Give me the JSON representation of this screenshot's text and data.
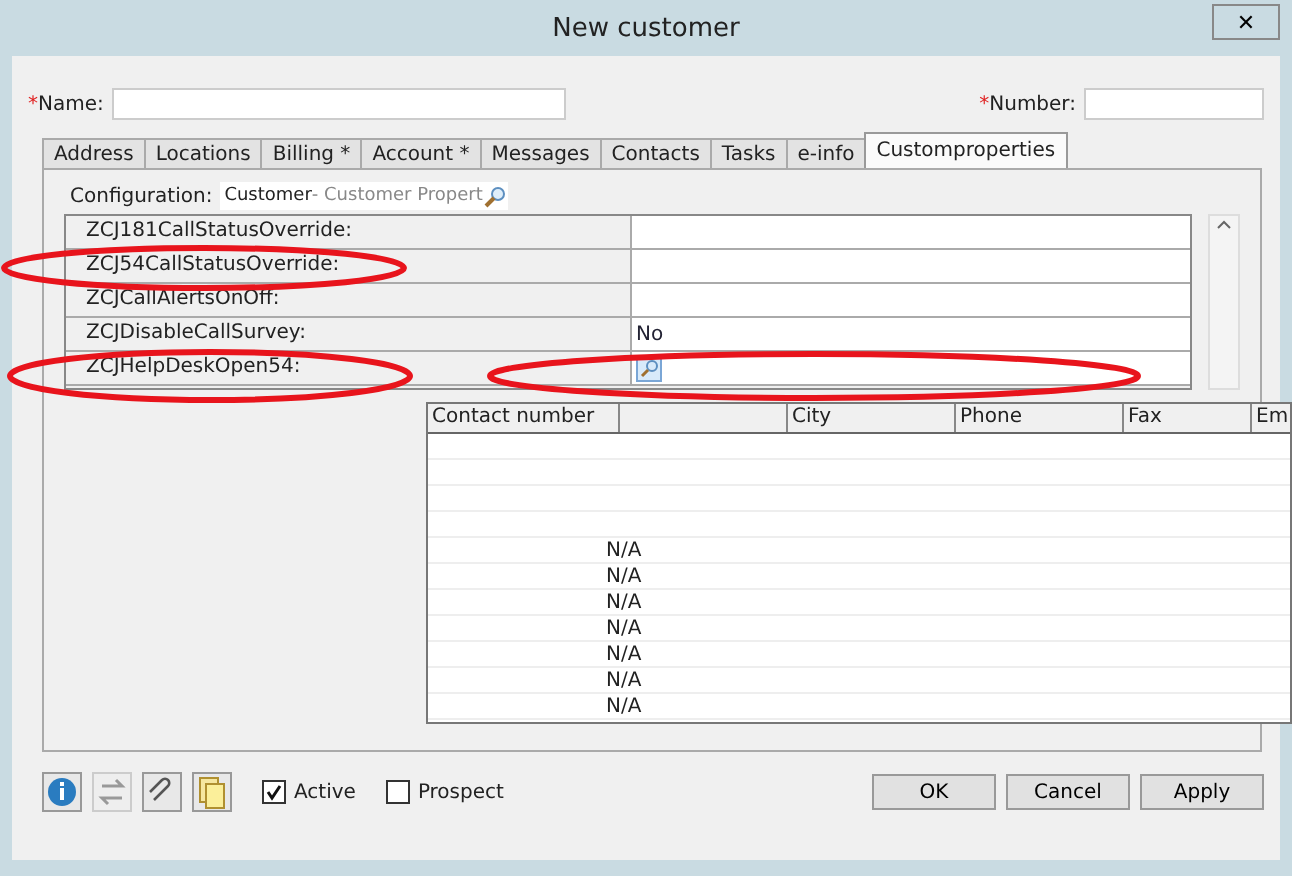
{
  "window": {
    "title": "New customer",
    "close": "✕"
  },
  "fields": [
    {
      "label": "Name:",
      "required": "*"
    },
    {
      "label": "Number:",
      "required": "*"
    }
  ],
  "tabs": [
    {
      "label": "Address",
      "selected": false
    },
    {
      "label": "Locations",
      "selected": false
    },
    {
      "label": "Billing  *",
      "selected": false
    },
    {
      "label": "Account *",
      "selected": false
    },
    {
      "label": "Messages",
      "selected": false
    },
    {
      "label": "Contacts",
      "selected": false
    },
    {
      "label": "Tasks",
      "selected": false
    },
    {
      "label": "e-info",
      "selected": false
    },
    {
      "label": "Customproperties",
      "selected": true
    }
  ],
  "configuration": {
    "label": "Configuration:",
    "value": "Customer",
    "hint": " - Customer Propert"
  },
  "properties": [
    {
      "name": "ZCJ181CallStatusOverride:"
    },
    {
      "name": "ZCJ54CallStatusOverride:"
    },
    {
      "name": "ZCJCallAlertsOnOff:"
    },
    {
      "name": "ZCJDisableCallSurvey:",
      "value": "No"
    },
    {
      "name": "ZCJHelpDeskOpen54:",
      "lookup": true
    }
  ],
  "dropdown": {
    "columns": [
      {
        "label": "Contact number"
      },
      {},
      {
        "label": "City"
      },
      {
        "label": "Phone"
      },
      {
        "label": "Fax"
      },
      {
        "label": "Em"
      }
    ],
    "rows": [
      {},
      {},
      {},
      {},
      {
        "name": "N/A"
      },
      {
        "name": "N/A"
      },
      {
        "name": "N/A"
      },
      {
        "name": "N/A"
      },
      {
        "name": "N/A"
      },
      {
        "name": "N/A"
      },
      {
        "name": "N/A"
      }
    ]
  },
  "footer": {
    "checkboxes": [
      {
        "label": "Active",
        "checked": true
      },
      {
        "label": "Prospect",
        "checked": false
      }
    ],
    "buttons": [
      "OK",
      "Cancel",
      "Apply"
    ]
  }
}
